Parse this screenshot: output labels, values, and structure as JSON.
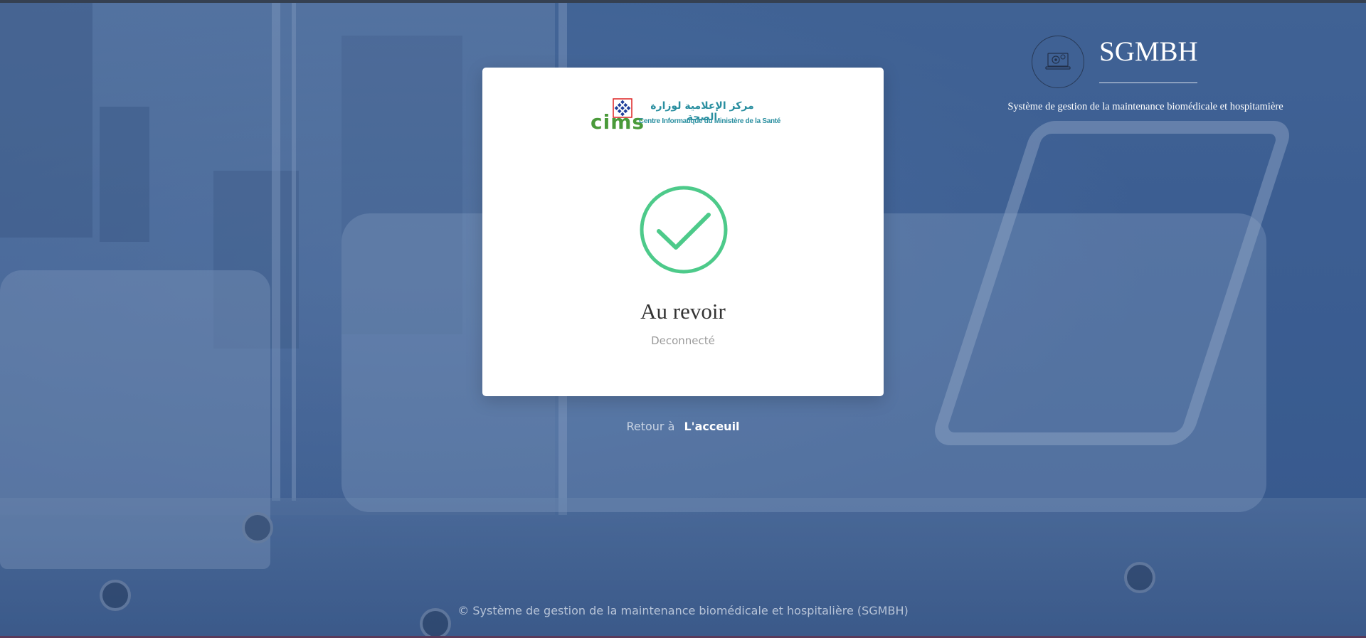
{
  "card": {
    "logo": {
      "cims": "cims",
      "arabic": "مركز الإعلامية لوزارة الصحة",
      "french": "Centre Informatique du Ministère de la Santé"
    },
    "title": "Au revoir",
    "subtitle": "Deconnecté",
    "check_icon_color": "#4dca8a"
  },
  "back": {
    "prefix": "Retour à",
    "link_label": "L'acceuil"
  },
  "brand": {
    "name": "SGMBH",
    "tagline": "Système de gestion de la maintenance biomédicale et hospitamière"
  },
  "footer": {
    "text": "© Système de gestion de la maintenance biomédicale et hospitalière (SGMBH)"
  },
  "colors": {
    "background_tint": "#436394",
    "card": "#ffffff",
    "success": "#4dca8a"
  }
}
